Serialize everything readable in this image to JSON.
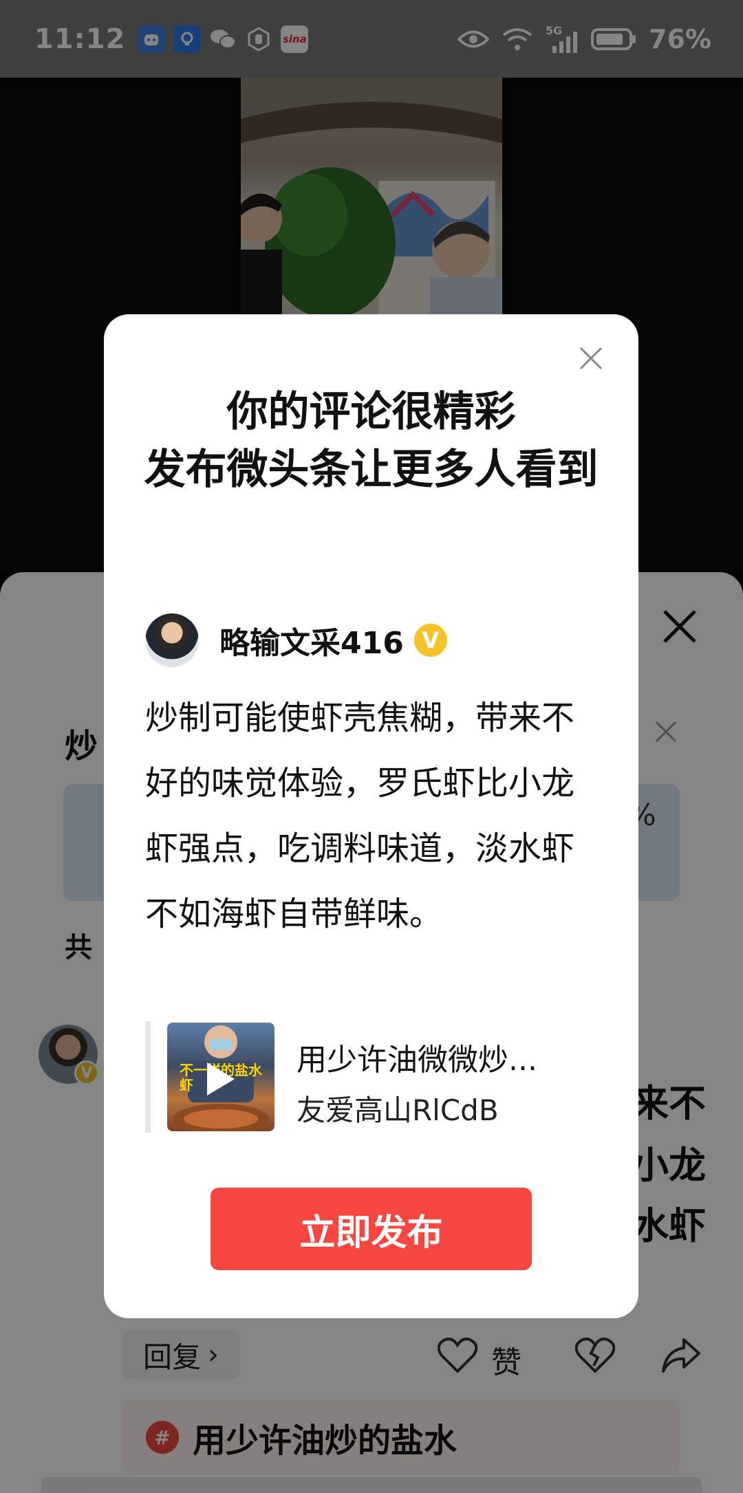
{
  "status_bar": {
    "time": "11:12",
    "network": "5G",
    "battery": "76%",
    "app_icons": [
      "bot-app-icon",
      "bulb-app-icon",
      "wechat-icon",
      "hand-app-icon",
      "sina-icon"
    ],
    "sina_label": "sina"
  },
  "modal": {
    "title_line1": "你的评论很精彩",
    "title_line2": "发布微头条让更多人看到",
    "author": "略输文采416",
    "verified_badge": "V",
    "comment": "炒制可能使虾壳焦糊，带来不好的味觉体验，罗氏虾比小龙虾强点，吃调料味道，淡水虾不如海虾自带鲜味。",
    "quote": {
      "title": "用少许油微微炒...",
      "author": "友爱高山RlCdB",
      "thumb_caption": "不一样的盐水虾"
    },
    "publish_label": "立即发布"
  },
  "sheet": {
    "title_char": "炒",
    "count_char": "共",
    "card_peek": "%",
    "comment_peek_lines": [
      "来不",
      "小龙",
      "水虾"
    ],
    "reply_label": "回复",
    "reply_arrow": "›",
    "like_label": "赞",
    "topic_hash": "#",
    "topic_text": "用少许油炒的盐水"
  },
  "colors": {
    "accent_red": "#f5473f",
    "verified_gold": "#f6c328",
    "status_bar": "#7a7a7a"
  }
}
